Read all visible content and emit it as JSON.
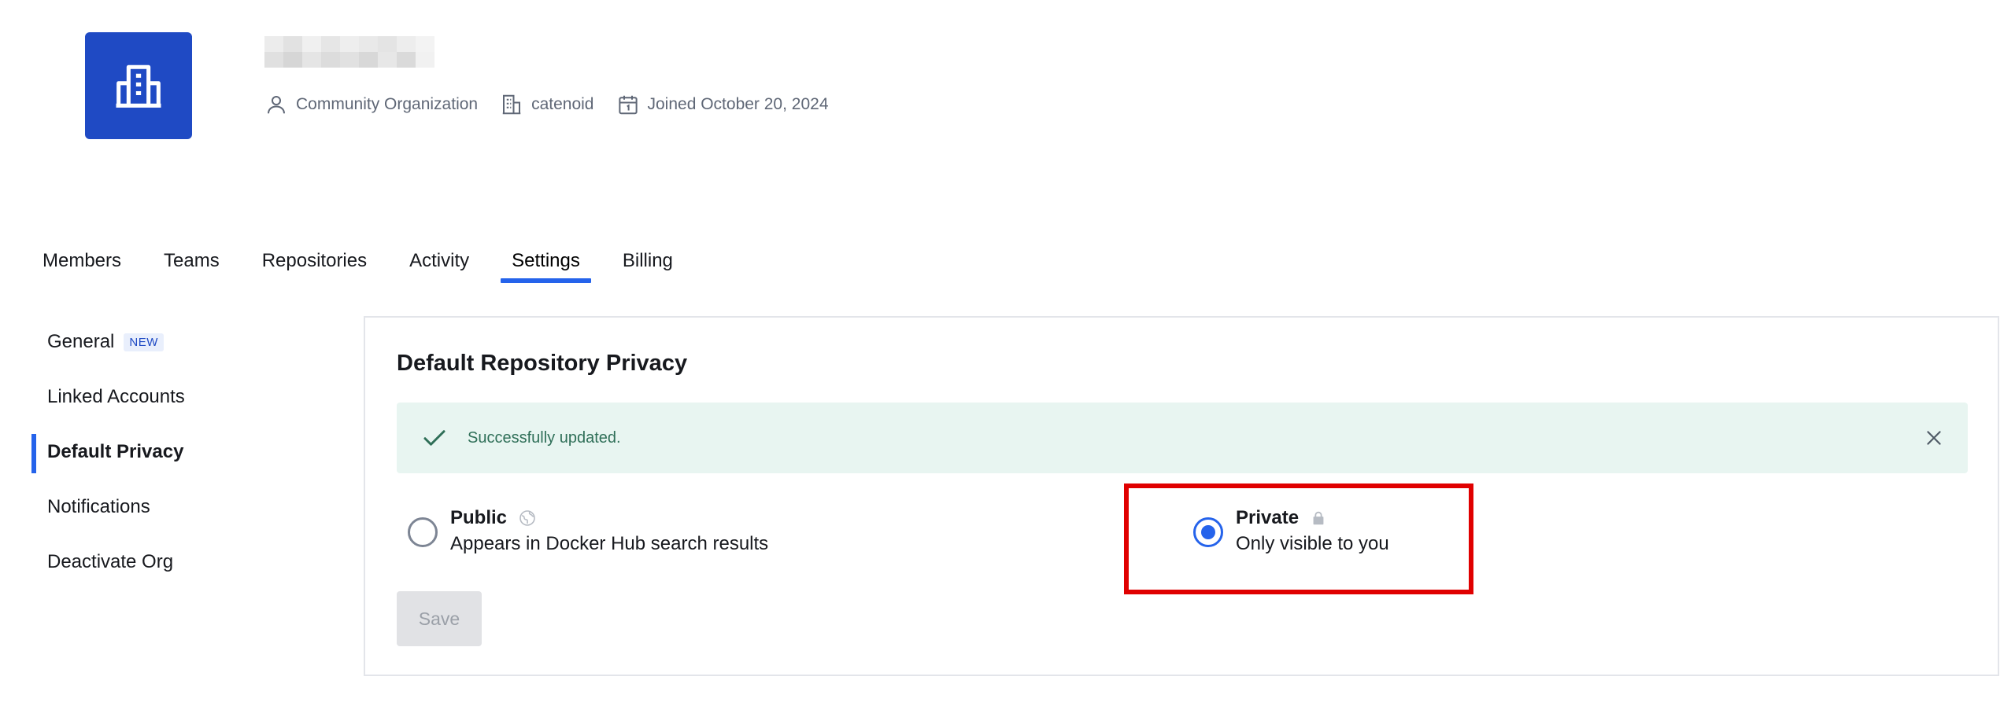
{
  "header": {
    "org_name_redacted": true,
    "meta": {
      "type": "Community Organization",
      "company": "catenoid",
      "joined": "Joined October 20, 2024"
    }
  },
  "tabs": [
    {
      "label": "Members",
      "active": false
    },
    {
      "label": "Teams",
      "active": false
    },
    {
      "label": "Repositories",
      "active": false
    },
    {
      "label": "Activity",
      "active": false
    },
    {
      "label": "Settings",
      "active": true
    },
    {
      "label": "Billing",
      "active": false
    }
  ],
  "sidenav": {
    "items": [
      {
        "label": "General",
        "badge": "NEW",
        "active": false
      },
      {
        "label": "Linked Accounts",
        "active": false
      },
      {
        "label": "Default Privacy",
        "active": true
      },
      {
        "label": "Notifications",
        "active": false
      },
      {
        "label": "Deactivate Org",
        "active": false
      }
    ]
  },
  "card": {
    "title": "Default Repository Privacy",
    "alert": {
      "message": "Successfully updated."
    },
    "options": {
      "public": {
        "label": "Public",
        "description": "Appears in Docker Hub search results",
        "checked": false
      },
      "private": {
        "label": "Private",
        "description": "Only visible to you",
        "checked": true
      }
    },
    "save_label": "Save"
  },
  "colors": {
    "accent": "#2563eb",
    "avatar_bg": "#1f4ac4",
    "alert_bg": "#e8f5f1",
    "highlight": "#e00000"
  },
  "icons": {
    "avatar": "building-icon",
    "meta_type": "user-icon",
    "meta_company": "building-icon",
    "meta_joined": "calendar-icon",
    "alert": "check-icon",
    "alert_close": "close-icon",
    "public": "globe-icon",
    "private": "lock-icon"
  }
}
